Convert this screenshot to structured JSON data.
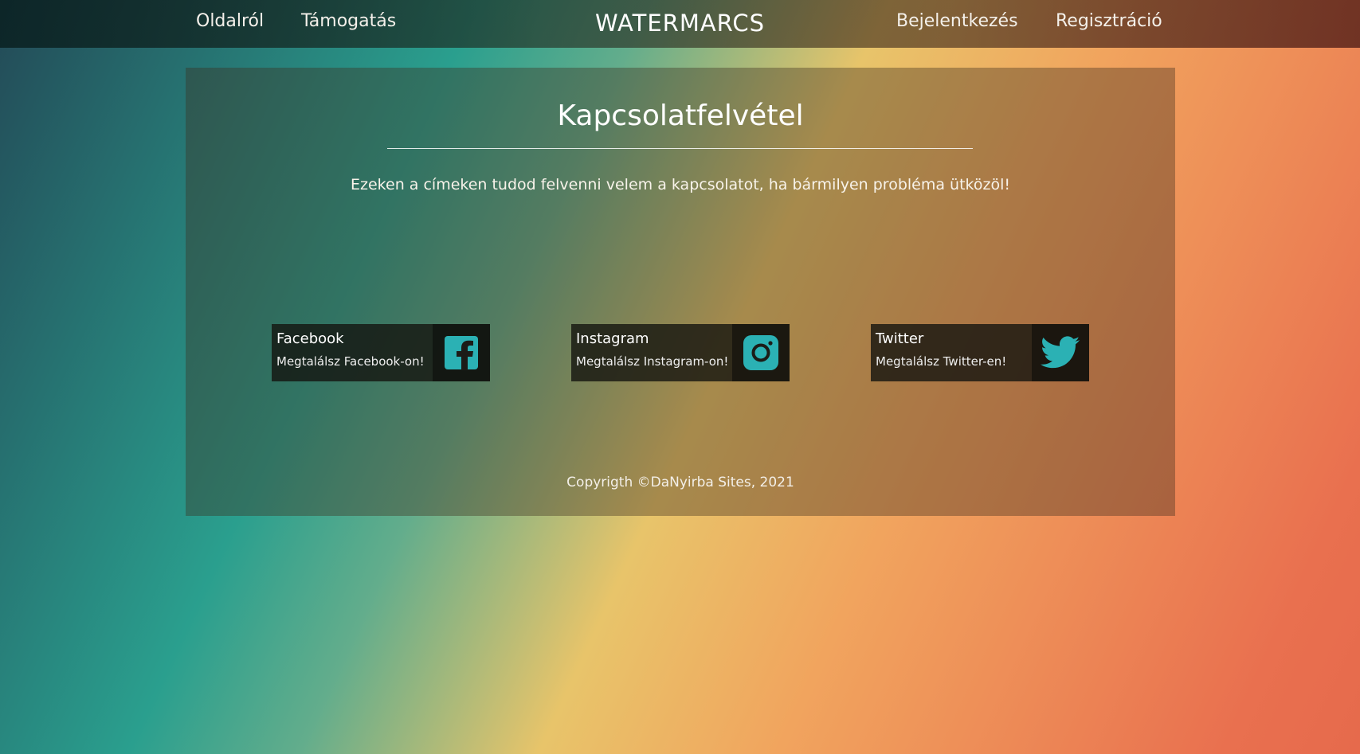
{
  "nav": {
    "left": [
      "Oldalról",
      "Támogatás"
    ],
    "brand": "WATERMARCS",
    "right": [
      "Bejelentkezés",
      "Regisztráció"
    ]
  },
  "contact": {
    "title": "Kapcsolatfelvétel",
    "intro": "Ezeken a címeken tudod felvenni velem a kapcsolatot, ha bármilyen probléma ütközöl!",
    "cards": [
      {
        "title": "Facebook",
        "subtitle": "Megtalálsz Facebook-on!",
        "icon": "facebook-icon"
      },
      {
        "title": "Instagram",
        "subtitle": "Megtalálsz Instagram-on!",
        "icon": "instagram-icon"
      },
      {
        "title": "Twitter",
        "subtitle": "Megtalálsz Twitter-en!",
        "icon": "twitter-icon"
      }
    ]
  },
  "footer": {
    "copyright": "Copyrigth ©DaNyirba Sites, 2021"
  },
  "colors": {
    "icon_accent": "#2bb1b4",
    "brand_text": "#ffffff"
  }
}
